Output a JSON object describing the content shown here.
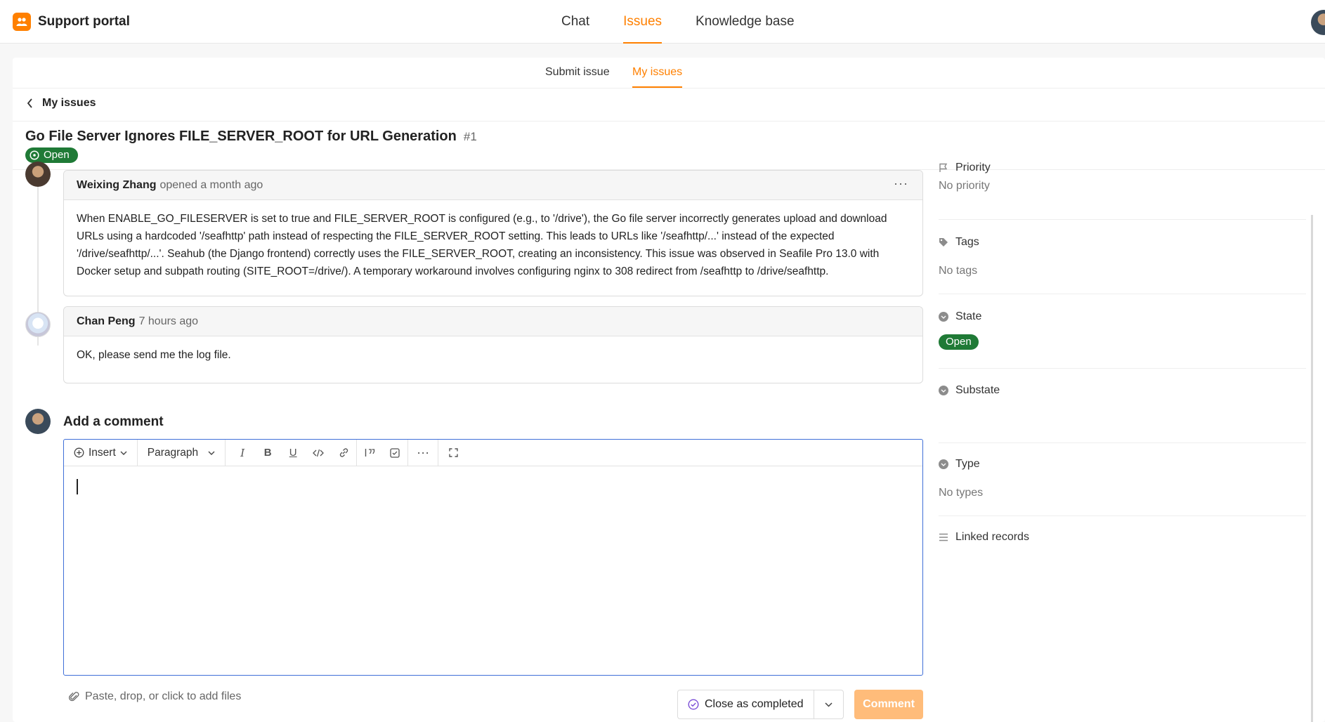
{
  "brand": {
    "name": "Support portal"
  },
  "topnav": {
    "chat": "Chat",
    "issues": "Issues",
    "knowledge": "Knowledge base"
  },
  "subnav": {
    "submit": "Submit issue",
    "my_issues": "My issues"
  },
  "breadcrumb": {
    "back_label": "My issues"
  },
  "issue": {
    "title": "Go File Server Ignores FILE_SERVER_ROOT for URL Generation",
    "number": "#1",
    "status": "Open"
  },
  "comments": [
    {
      "author": "Weixing Zhang",
      "meta": "opened a month ago",
      "body": "When ENABLE_GO_FILESERVER is set to true and FILE_SERVER_ROOT is configured (e.g., to '/drive'), the Go file server incorrectly generates upload and download URLs using a hardcoded '/seafhttp' path instead of respecting the FILE_SERVER_ROOT setting. This leads to URLs like '/seafhttp/...' instead of the expected '/drive/seafhttp/...'. Seahub (the Django frontend) correctly uses the FILE_SERVER_ROOT, creating an inconsistency. This issue was observed in Seafile Pro 13.0 with Docker setup and subpath routing (SITE_ROOT=/drive/). A temporary workaround involves configuring nginx to 308 redirect from /seafhttp to /drive/seafhttp."
    },
    {
      "author": "Chan Peng",
      "meta": "7 hours ago",
      "body": "OK, please send me the log file."
    }
  ],
  "editor": {
    "heading": "Add a comment",
    "insert": "Insert",
    "paragraph": "Paragraph"
  },
  "footer": {
    "files_hint": "Paste, drop, or click to add files",
    "close_label": "Close as completed",
    "comment_label": "Comment"
  },
  "sidebar": {
    "priority": {
      "label": "Priority",
      "value": "No priority"
    },
    "tags": {
      "label": "Tags",
      "value": "No tags"
    },
    "state": {
      "label": "State",
      "value": "Open"
    },
    "substate": {
      "label": "Substate"
    },
    "type": {
      "label": "Type",
      "value": "No types"
    },
    "linked": {
      "label": "Linked records"
    }
  },
  "colors": {
    "accent": "#ff8000",
    "open_green": "#1f7a36",
    "editor_border": "#3f6fd8"
  }
}
